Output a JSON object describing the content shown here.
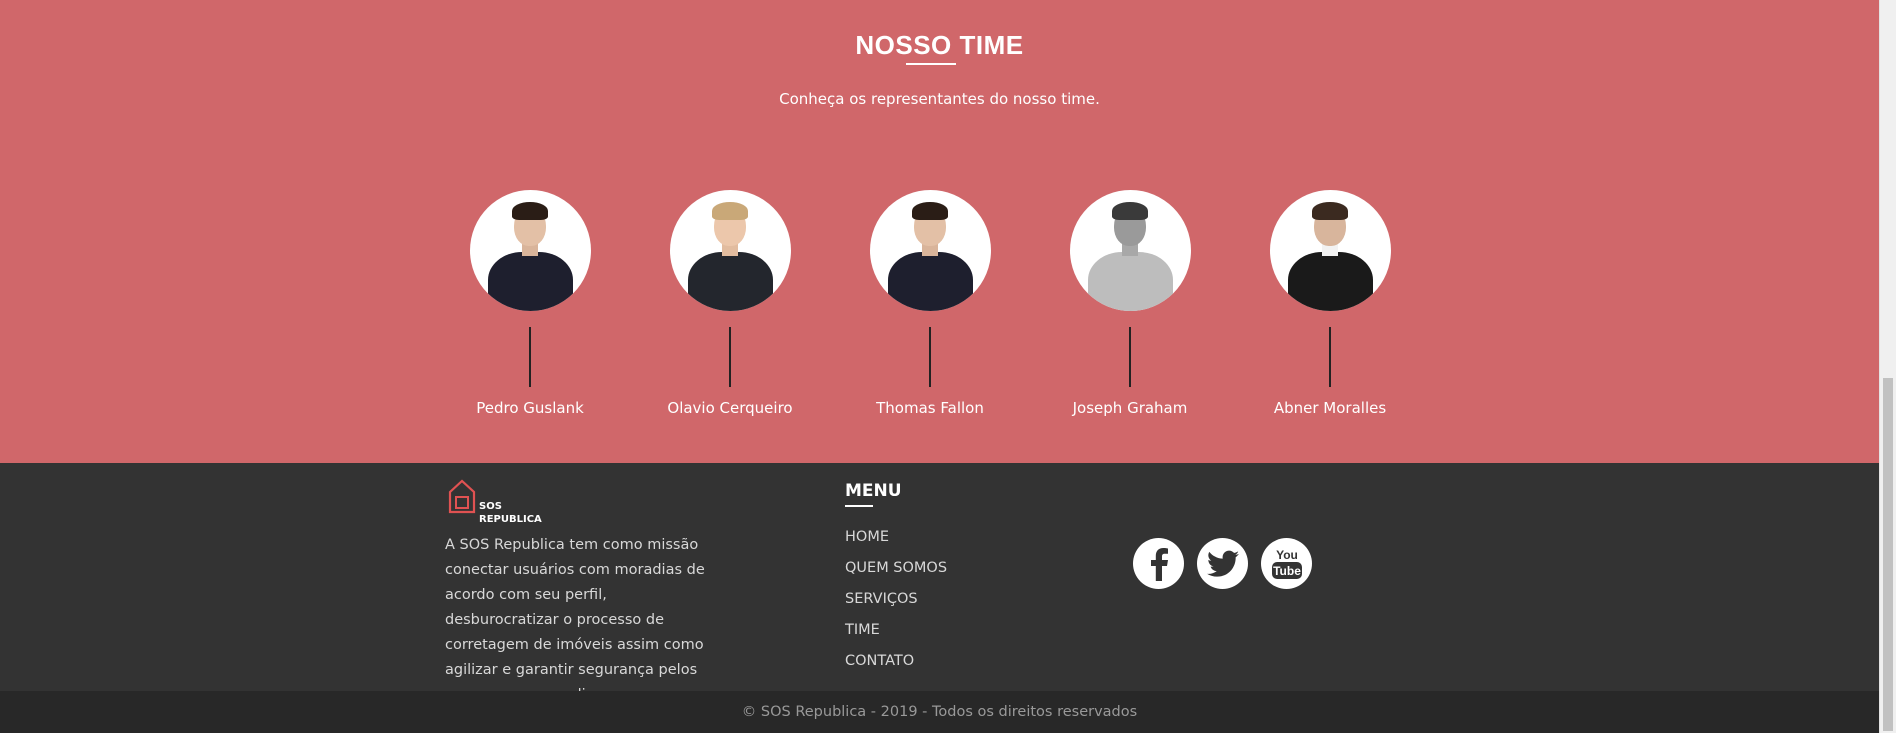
{
  "team": {
    "title": "NOSSO TIME",
    "subtitle": "Conheça os representantes do nosso time.",
    "members": [
      {
        "name": "Pedro Guslank"
      },
      {
        "name": "Olavio Cerqueiro"
      },
      {
        "name": "Thomas Fallon"
      },
      {
        "name": "Joseph Graham"
      },
      {
        "name": "Abner Moralles"
      }
    ]
  },
  "footer": {
    "logo_line1": "SOS",
    "logo_line2": "REPUBLICA",
    "mission": "A SOS Republica tem como missão conectar usuários com moradias de acordo com seu perfil, desburocratizar o processo de corretagem de imóveis assim como agilizar e garantir segurança pelos seus processos online.",
    "menu_title": "MENU",
    "menu": [
      "HOME",
      "QUEM SOMOS",
      "SERVIÇOS",
      "TIME",
      "CONTATO"
    ],
    "socials": [
      "facebook-icon",
      "twitter-icon",
      "youtube-icon"
    ],
    "copyright": "© SOS Republica - 2019 - Todos os direitos reservados"
  },
  "colors": {
    "team_bg": "#d0676a",
    "footer_bg": "#333333",
    "copyright_bg": "#282828",
    "logo_red": "#e05252"
  }
}
